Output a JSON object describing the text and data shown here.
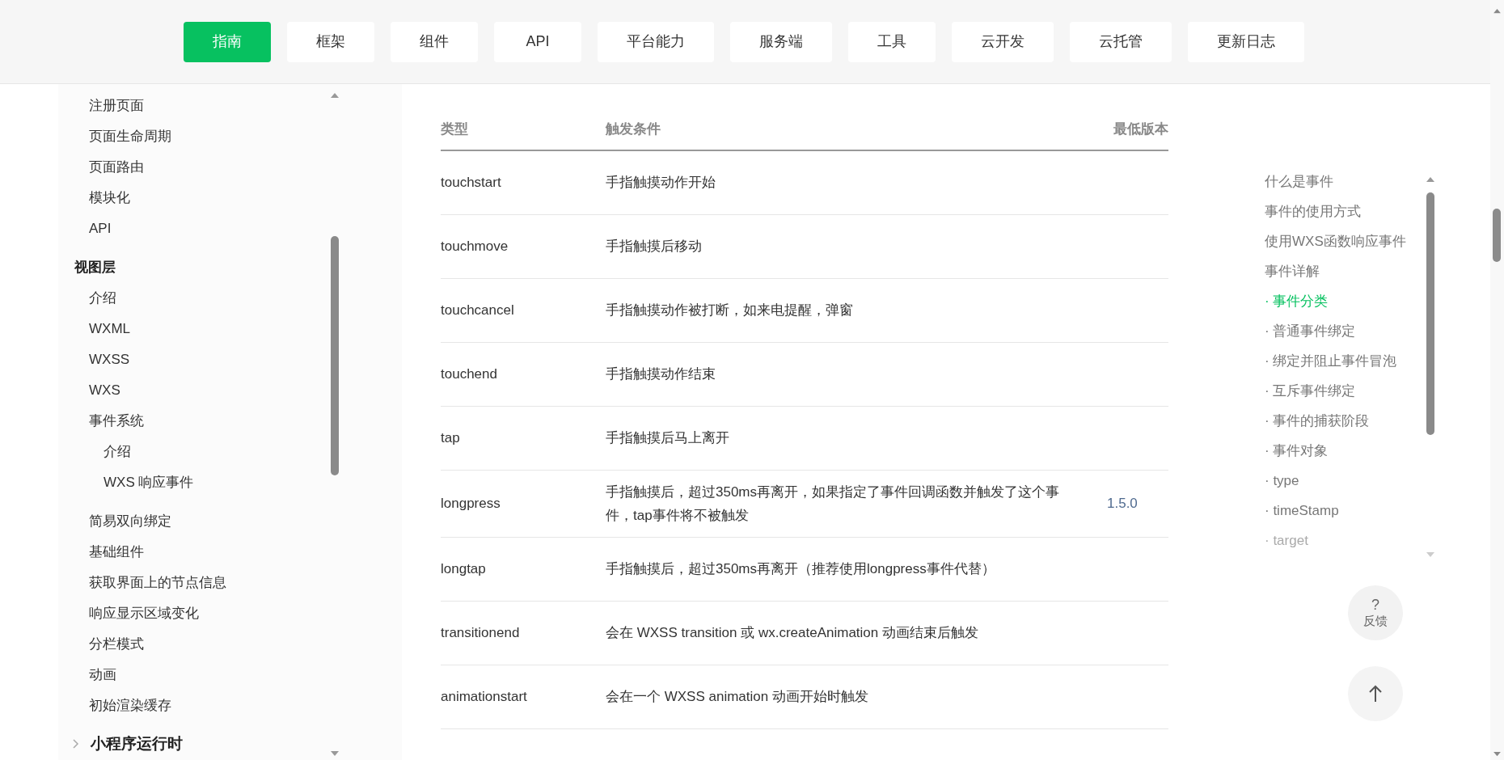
{
  "nav": {
    "tabs": [
      {
        "label": "指南",
        "selected": true
      },
      {
        "label": "框架",
        "selected": false
      },
      {
        "label": "组件",
        "selected": false
      },
      {
        "label": "API",
        "selected": false
      },
      {
        "label": "平台能力",
        "selected": false
      },
      {
        "label": "服务端",
        "selected": false
      },
      {
        "label": "工具",
        "selected": false
      },
      {
        "label": "云开发",
        "selected": false
      },
      {
        "label": "云托管",
        "selected": false
      },
      {
        "label": "更新日志",
        "selected": false
      }
    ]
  },
  "sidebar": {
    "items": [
      {
        "children": [
          {
            "label": "注册页面"
          },
          {
            "label": "页面生命周期"
          },
          {
            "label": "页面路由"
          },
          {
            "label": "模块化"
          },
          {
            "label": "API"
          }
        ]
      },
      {
        "label": "视图层",
        "children": [
          {
            "label": "介绍"
          },
          {
            "label": "WXML"
          },
          {
            "label": "WXSS"
          },
          {
            "label": "WXS"
          },
          {
            "label": "事件系统",
            "children": [
              {
                "label": "介绍"
              },
              {
                "label": "WXS 响应事件"
              }
            ]
          },
          {
            "label": "简易双向绑定"
          },
          {
            "label": "基础组件"
          },
          {
            "label": "获取界面上的节点信息"
          },
          {
            "label": "响应显示区域变化"
          },
          {
            "label": "分栏模式"
          },
          {
            "label": "动画"
          },
          {
            "label": "初始渲染缓存"
          }
        ]
      }
    ],
    "sections": [
      {
        "label": "小程序运行时",
        "expanded": false
      }
    ]
  },
  "table": {
    "columns": [
      "类型",
      "触发条件",
      "最低版本"
    ],
    "rows": [
      [
        "touchstart",
        "手指触摸动作开始",
        ""
      ],
      [
        "touchmove",
        "手指触摸后移动",
        ""
      ],
      [
        "touchcancel",
        "手指触摸动作被打断，如来电提醒，弹窗",
        ""
      ],
      [
        "touchend",
        "手指触摸动作结束",
        ""
      ],
      [
        "tap",
        "手指触摸后马上离开",
        ""
      ],
      [
        "longpress",
        "手指触摸后，超过350ms再离开，如果指定了事件回调函数并触发了这个事件，tap事件将不被触发",
        "1.5.0"
      ],
      [
        "longtap",
        "手指触摸后，超过350ms再离开（推荐使用longpress事件代替）",
        ""
      ],
      [
        "transitionend",
        "会在 WXSS transition 或 wx.createAnimation 动画结束后触发",
        ""
      ],
      [
        "animationstart",
        "会在一个 WXSS animation 动画开始时触发",
        ""
      ]
    ]
  },
  "toc": {
    "items": [
      {
        "label": "什么是事件",
        "selected": false,
        "dimmed": false
      },
      {
        "label": "事件的使用方式",
        "selected": false,
        "dimmed": false
      },
      {
        "label": "使用WXS函数响应事件",
        "selected": false,
        "dimmed": false
      },
      {
        "label": "事件详解",
        "selected": false,
        "dimmed": false
      },
      {
        "label": "· 事件分类",
        "selected": true,
        "dimmed": false
      },
      {
        "label": "· 普通事件绑定",
        "selected": false,
        "dimmed": false
      },
      {
        "label": "· 绑定并阻止事件冒泡",
        "selected": false,
        "dimmed": false
      },
      {
        "label": "· 互斥事件绑定",
        "selected": false,
        "dimmed": false
      },
      {
        "label": "· 事件的捕获阶段",
        "selected": false,
        "dimmed": false
      },
      {
        "label": "· 事件对象",
        "selected": false,
        "dimmed": false
      },
      {
        "label": "· type",
        "selected": false,
        "dimmed": false
      },
      {
        "label": "· timeStamp",
        "selected": false,
        "dimmed": false
      },
      {
        "label": "· target",
        "selected": false,
        "dimmed": true
      }
    ]
  },
  "feedback": {
    "icon": "?",
    "label": "反馈"
  }
}
